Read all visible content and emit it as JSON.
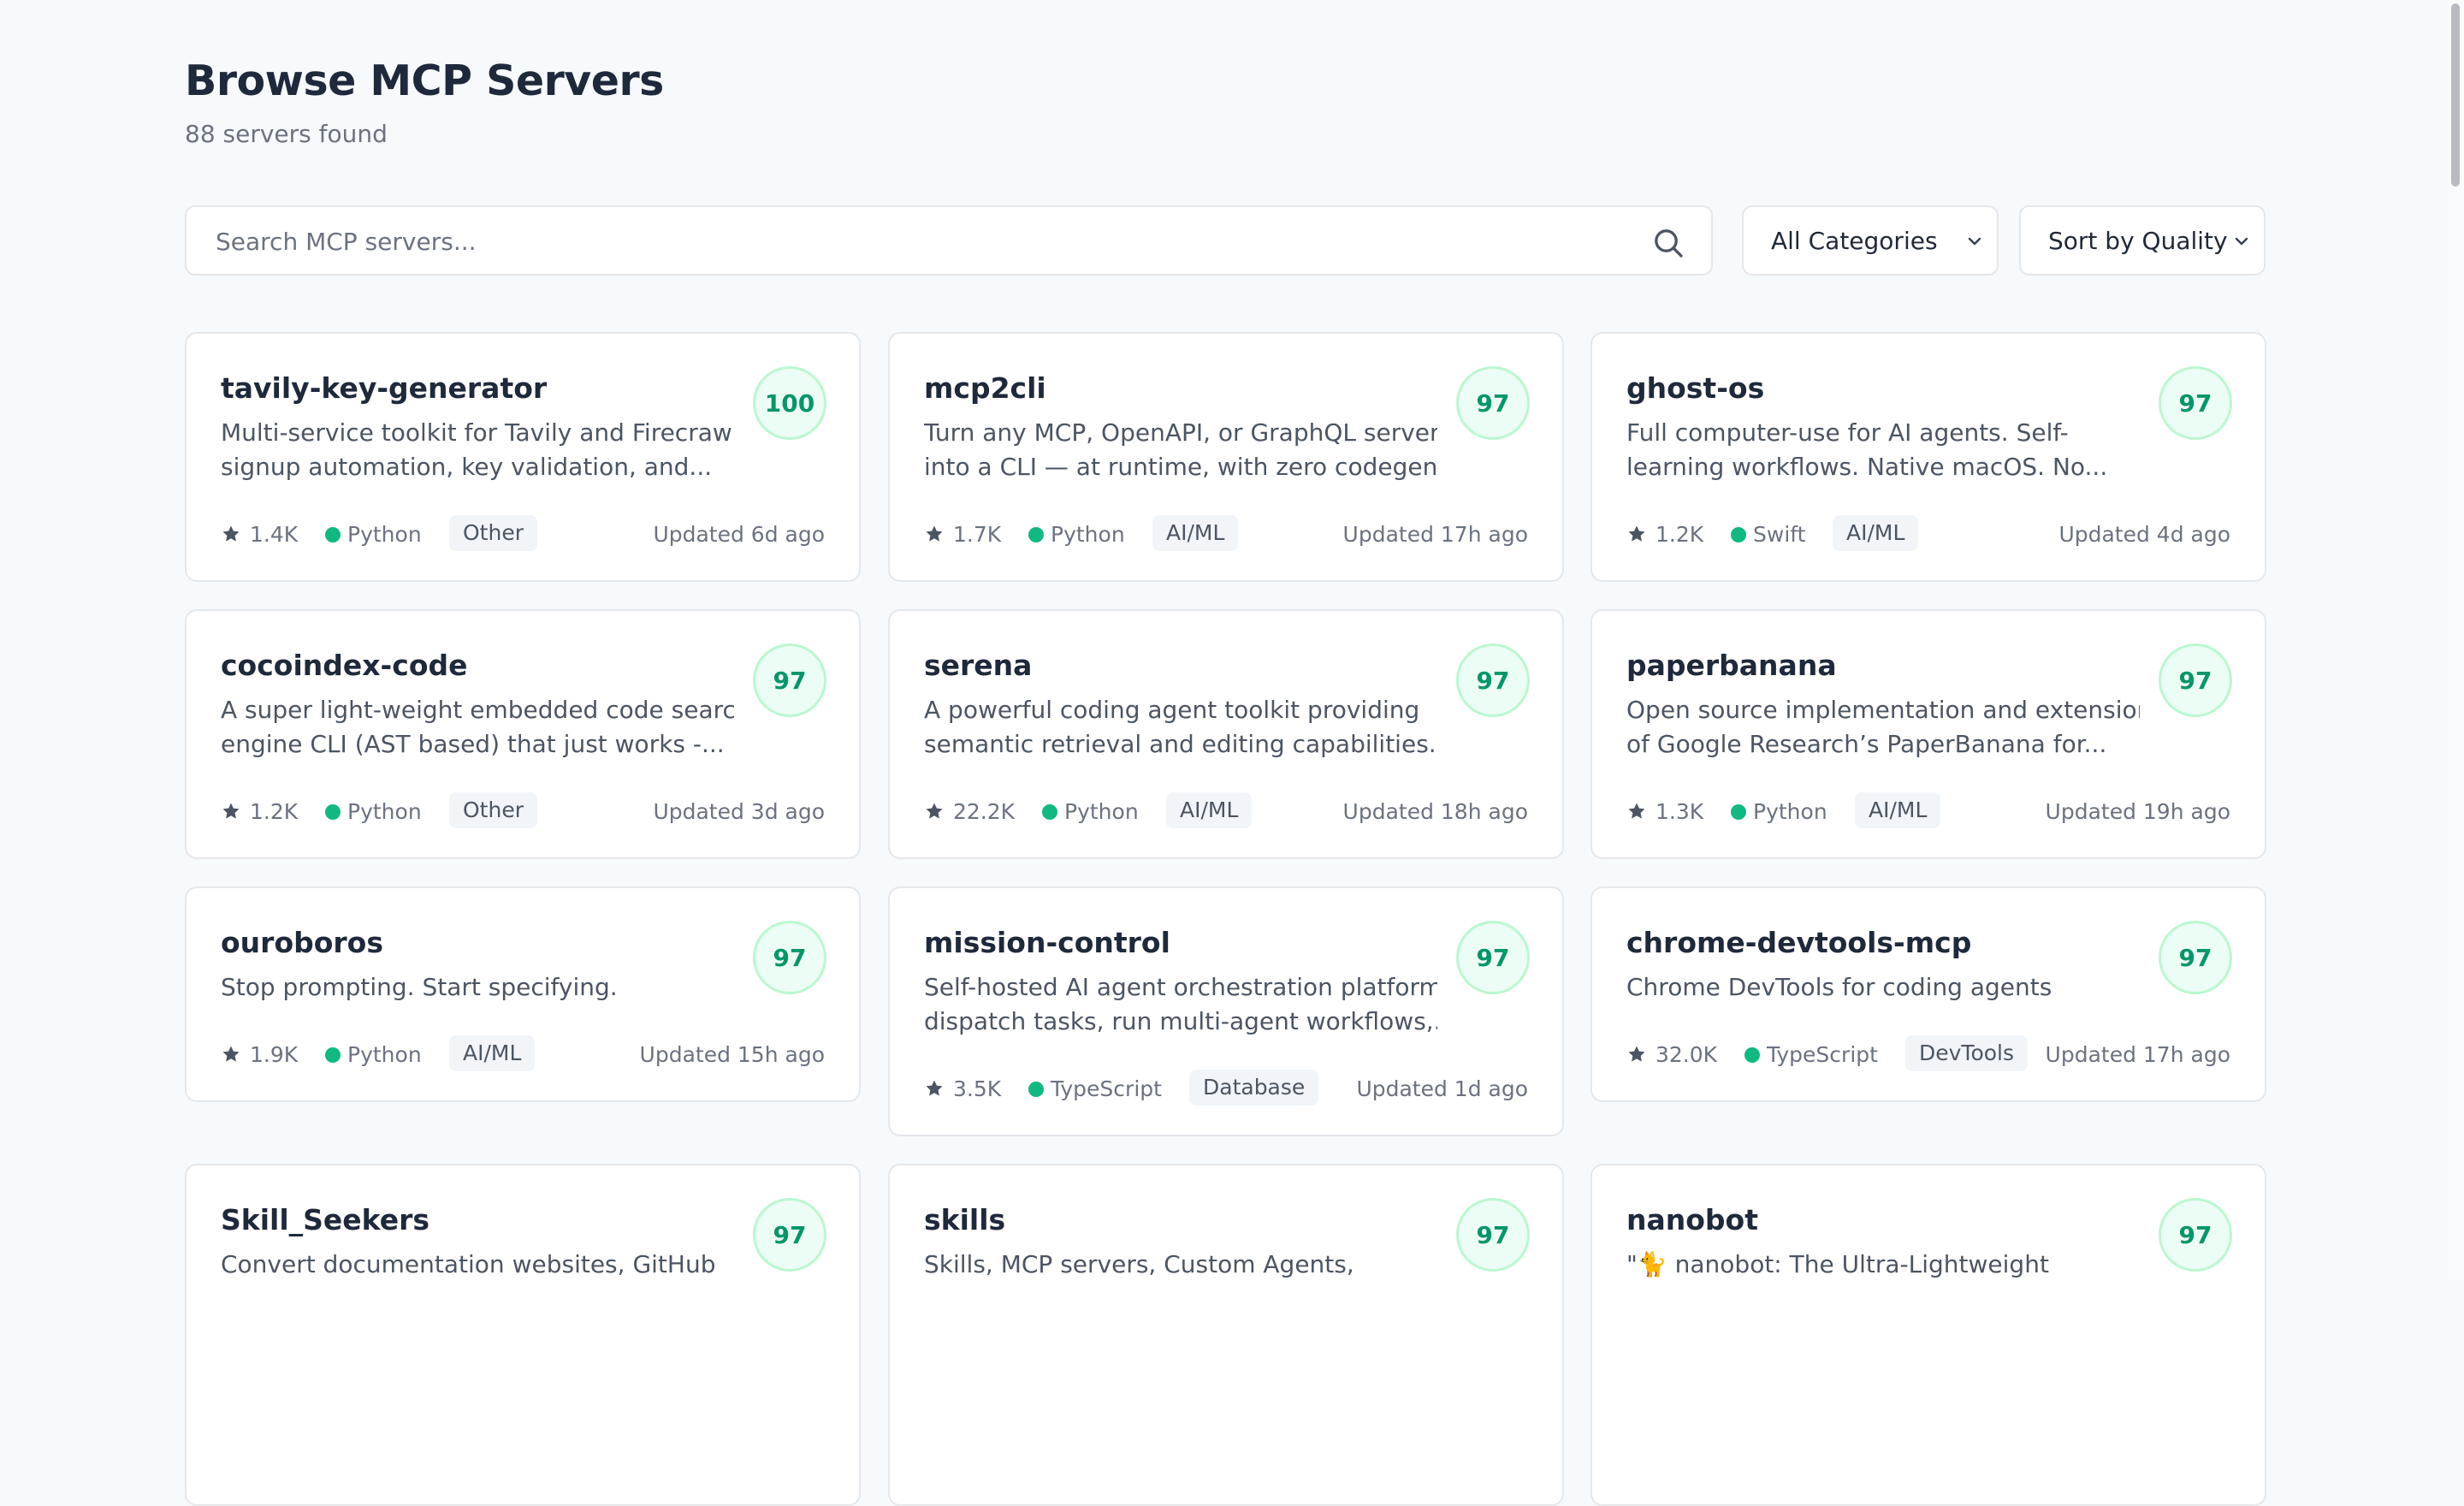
{
  "header": {
    "title": "Browse MCP Servers",
    "count_text": "88 servers found"
  },
  "search": {
    "placeholder": "Search MCP servers...",
    "value": ""
  },
  "filters": {
    "category": "All Categories",
    "sort": "Sort by Quality"
  },
  "colors": {
    "accent": "#059669",
    "language_dot": "#10b981"
  },
  "servers": [
    {
      "name": "tavily-key-generator",
      "description_lines": [
        "Multi-service toolkit for Tavily and Firecrawl",
        "signup automation, key validation, and..."
      ],
      "score": "100",
      "stars": "1.4K",
      "language": "Python",
      "category": "Other",
      "updated": "Updated 6d ago"
    },
    {
      "name": "mcp2cli",
      "description_lines": [
        "Turn any MCP, OpenAPI, or GraphQL server",
        "into a CLI — at runtime, with zero codegen"
      ],
      "score": "97",
      "stars": "1.7K",
      "language": "Python",
      "category": "AI/ML",
      "updated": "Updated 17h ago"
    },
    {
      "name": "ghost-os",
      "description_lines": [
        "Full computer-use for AI agents. Self-",
        "learning workflows. Native macOS. No..."
      ],
      "score": "97",
      "stars": "1.2K",
      "language": "Swift",
      "category": "AI/ML",
      "updated": "Updated 4d ago"
    },
    {
      "name": "cocoindex-code",
      "description_lines": [
        "A super light-weight embedded code search",
        "engine CLI (AST based) that just works -..."
      ],
      "score": "97",
      "stars": "1.2K",
      "language": "Python",
      "category": "Other",
      "updated": "Updated 3d ago"
    },
    {
      "name": "serena",
      "description_lines": [
        "A powerful coding agent toolkit providing",
        "semantic retrieval and editing capabilities..."
      ],
      "score": "97",
      "stars": "22.2K",
      "language": "Python",
      "category": "AI/ML",
      "updated": "Updated 18h ago"
    },
    {
      "name": "paperbanana",
      "description_lines": [
        "Open source implementation and extension",
        "of Google Research’s PaperBanana for..."
      ],
      "score": "97",
      "stars": "1.3K",
      "language": "Python",
      "category": "AI/ML",
      "updated": "Updated 19h ago"
    },
    {
      "name": "ouroboros",
      "description_lines": [
        "Stop prompting. Start specifying."
      ],
      "score": "97",
      "stars": "1.9K",
      "language": "Python",
      "category": "AI/ML",
      "updated": "Updated 15h ago"
    },
    {
      "name": "mission-control",
      "description_lines": [
        "Self-hosted AI agent orchestration platform:",
        "dispatch tasks, run multi-agent workflows,..."
      ],
      "score": "97",
      "stars": "3.5K",
      "language": "TypeScript",
      "category": "Database",
      "updated": "Updated 1d ago"
    },
    {
      "name": "chrome-devtools-mcp",
      "description_lines": [
        "Chrome DevTools for coding agents"
      ],
      "score": "97",
      "stars": "32.0K",
      "language": "TypeScript",
      "category": "DevTools",
      "updated": "Updated 17h ago"
    },
    {
      "name": "Skill_Seekers",
      "description_lines": [
        "Convert documentation websites, GitHub"
      ],
      "score": "97"
    },
    {
      "name": "skills",
      "description_lines": [
        "Skills, MCP servers, Custom Agents,"
      ],
      "score": "97"
    },
    {
      "name": "nanobot",
      "description_lines": [
        "\"🐈 nanobot: The Ultra-Lightweight"
      ],
      "score": "97"
    }
  ]
}
